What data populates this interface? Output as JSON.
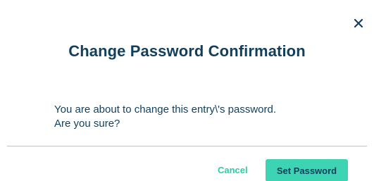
{
  "dialog": {
    "title": "Change Password Confirmation",
    "message_line1": "You are about to change this entry\\'s password.",
    "message_line2": "Are you sure?",
    "close_icon": "close-icon",
    "cancel_label": "Cancel",
    "confirm_label": "Set Password"
  },
  "colors": {
    "title": "#123f5c",
    "accent": "#3dd4b3",
    "cancel_text": "#31c9a8",
    "divider": "#8fd5e8"
  }
}
